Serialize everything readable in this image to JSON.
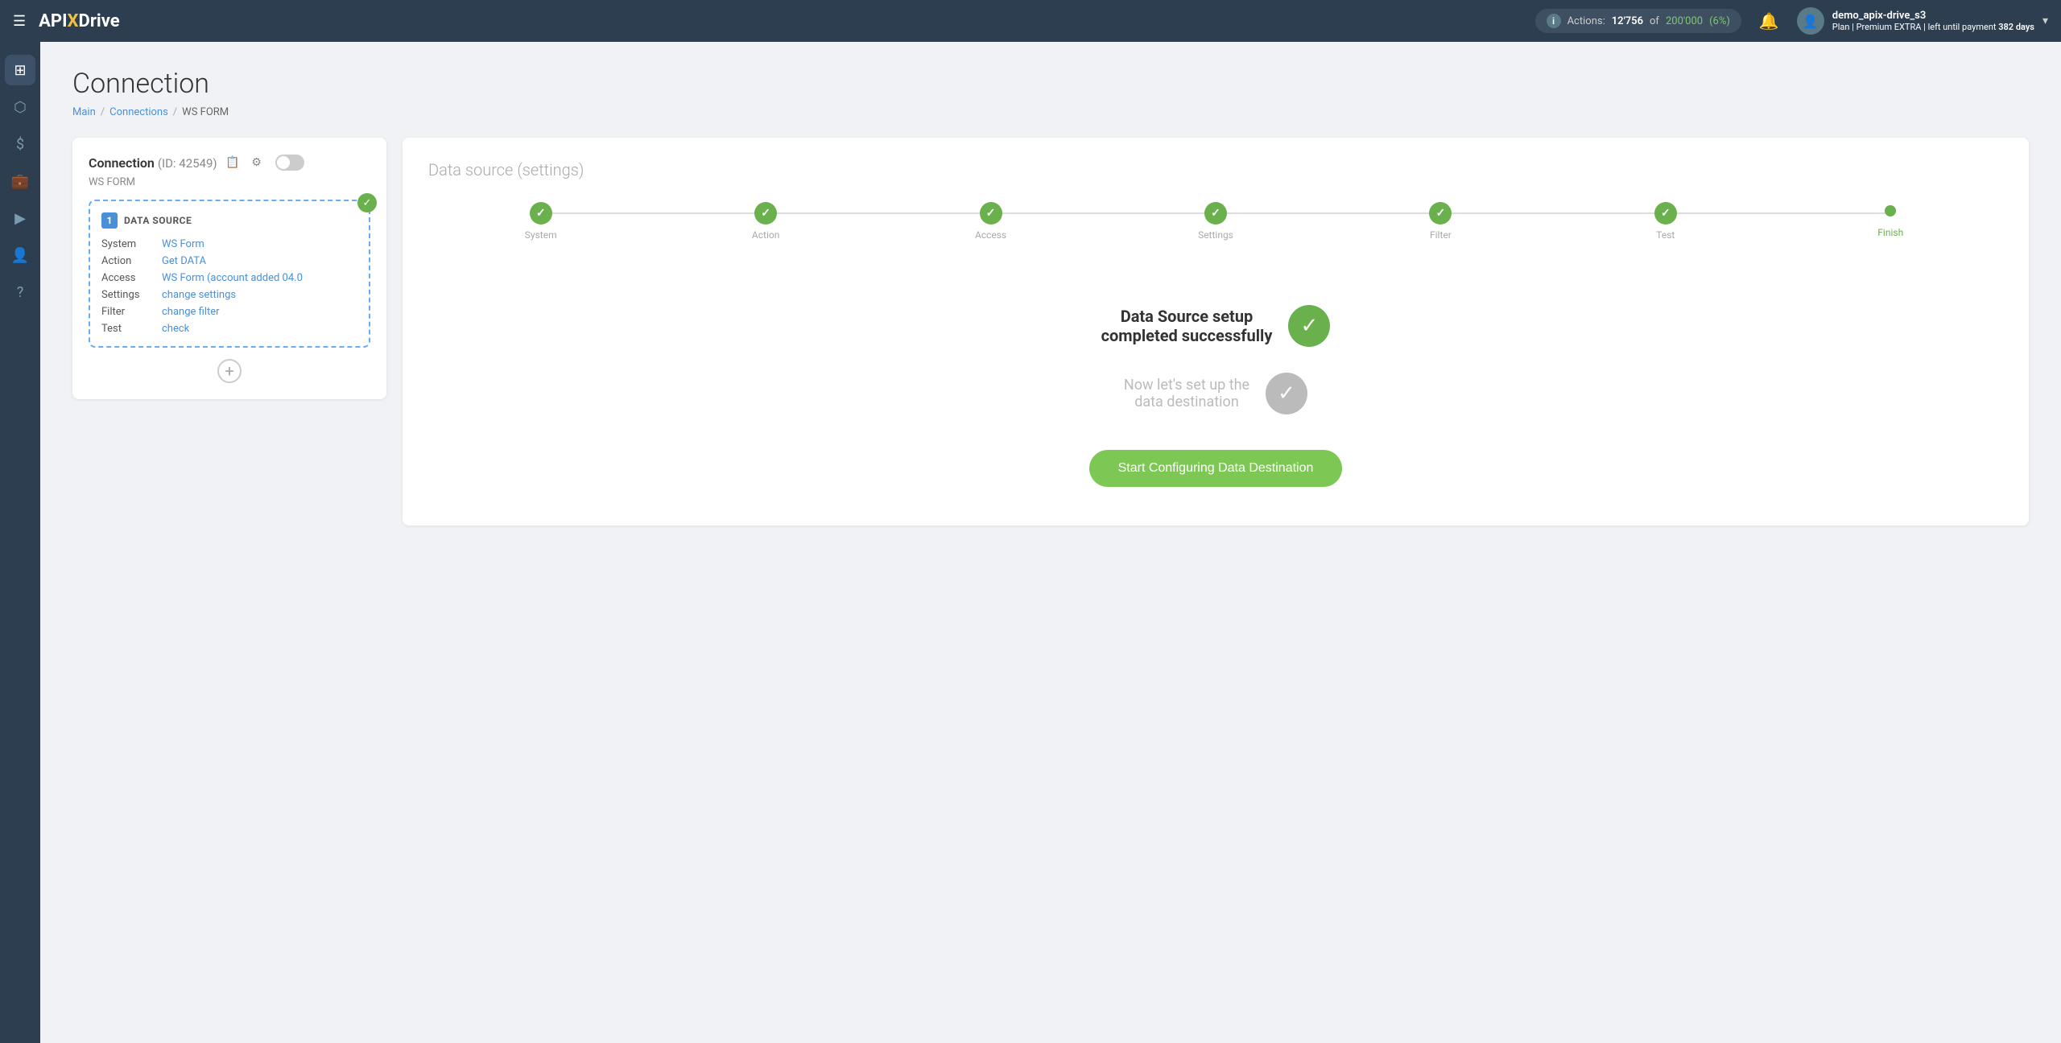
{
  "topnav": {
    "menu_icon": "☰",
    "logo_api": "API",
    "logo_x": "X",
    "logo_drive": "Drive",
    "actions_label": "Actions:",
    "actions_count": "12'756",
    "actions_of": "of",
    "actions_total": "200'000",
    "actions_pct": "(6%)",
    "notif_icon": "🔔",
    "user_name": "demo_apix-drive_s3",
    "user_plan_prefix": "Plan |",
    "user_plan": "Premium EXTRA",
    "user_plan_suffix": "| left until payment",
    "user_days": "382 days",
    "chevron": "▾"
  },
  "sidebar": {
    "items": [
      {
        "icon": "⊞",
        "name": "home"
      },
      {
        "icon": "⬡",
        "name": "connections"
      },
      {
        "icon": "$",
        "name": "billing"
      },
      {
        "icon": "💼",
        "name": "services"
      },
      {
        "icon": "▶",
        "name": "tutorials"
      },
      {
        "icon": "👤",
        "name": "profile"
      },
      {
        "icon": "?",
        "name": "help"
      }
    ]
  },
  "page": {
    "title": "Connection",
    "breadcrumb_main": "Main",
    "breadcrumb_sep1": "/",
    "breadcrumb_connections": "Connections",
    "breadcrumb_sep2": "/",
    "breadcrumb_current": "WS FORM"
  },
  "left_card": {
    "connection_label": "Connection",
    "connection_id": "(ID: 42549)",
    "ws_form_label": "WS FORM",
    "data_source_num": "1",
    "data_source_title": "DATA SOURCE",
    "rows": [
      {
        "label": "System",
        "value": "WS Form"
      },
      {
        "label": "Action",
        "value": "Get DATA"
      },
      {
        "label": "Access",
        "value": "WS Form (account added 04.0"
      },
      {
        "label": "Settings",
        "value": "change settings"
      },
      {
        "label": "Filter",
        "value": "change filter"
      },
      {
        "label": "Test",
        "value": "check"
      }
    ],
    "add_icon": "+"
  },
  "right_card": {
    "title": "Data source",
    "title_sub": "(settings)",
    "steps": [
      {
        "label": "System",
        "state": "done"
      },
      {
        "label": "Action",
        "state": "done"
      },
      {
        "label": "Access",
        "state": "done"
      },
      {
        "label": "Settings",
        "state": "done"
      },
      {
        "label": "Filter",
        "state": "done"
      },
      {
        "label": "Test",
        "state": "done"
      },
      {
        "label": "Finish",
        "state": "current"
      }
    ],
    "success_main": "Data Source setup\ncompleted successfully",
    "success_sub": "Now let's set up the\ndata destination",
    "cta_button": "Start Configuring Data Destination"
  }
}
